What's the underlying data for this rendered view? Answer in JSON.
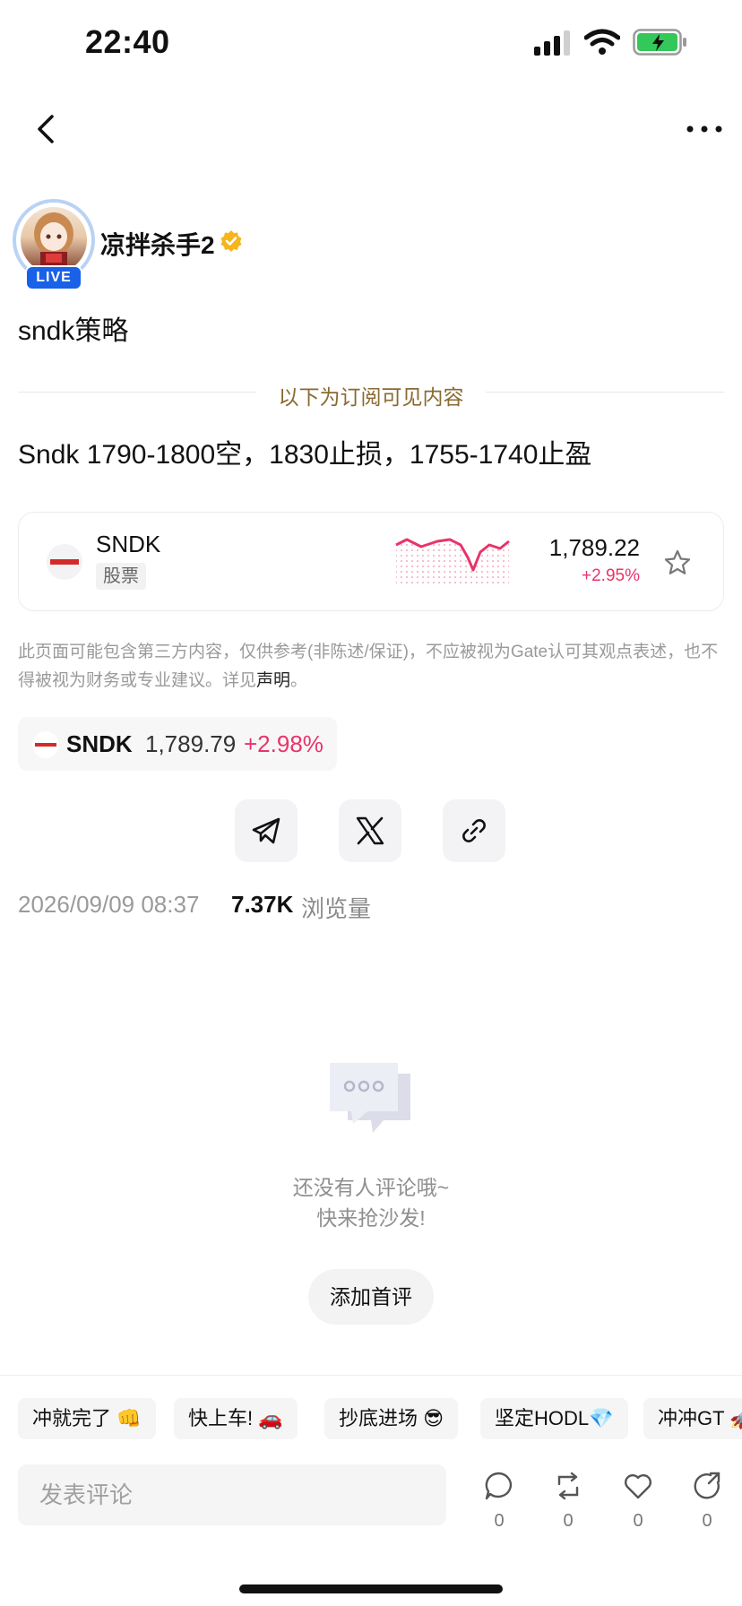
{
  "status_bar": {
    "time": "22:40"
  },
  "author": {
    "name": "凉拌杀手2",
    "live_badge": "LIVE"
  },
  "post": {
    "title": "sndk策略",
    "subscription_divider": "以下为订阅可见内容",
    "body": "Sndk 1790-1800空，1830止损，1755-1740止盈"
  },
  "stock_card": {
    "symbol": "SNDK",
    "type": "股票",
    "price": "1,789.22",
    "change": "+2.95%",
    "change_color": "#e8346a"
  },
  "disclaimer": {
    "text": "此页面可能包含第三方内容，仅供参考(非陈述/保证)，不应被视为Gate认可其观点表述，也不得被视为财务或专业建议。详见",
    "link": "声明",
    "suffix": "。"
  },
  "ticker_chip": {
    "symbol": "SNDK",
    "price": "1,789.79",
    "change": "+2.98%"
  },
  "meta": {
    "date": "2026/09/09 08:37",
    "views_count": "7.37K",
    "views_label": "浏览量"
  },
  "empty_state": {
    "line1": "还没有人评论哦~",
    "line2": "快来抢沙发!",
    "button": "添加首评"
  },
  "quick_replies": [
    "冲就完了 👊",
    "快上车! 🚗",
    "抄底进场 😎",
    "坚定HODL💎",
    "冲冲GT 🚀"
  ],
  "comment_box": {
    "placeholder": "发表评论"
  },
  "actions": {
    "comments": "0",
    "reposts": "0",
    "likes": "0",
    "shares": "0"
  },
  "icons": [
    "back-icon",
    "more-icon",
    "verified-icon",
    "star-icon",
    "telegram-icon",
    "x-icon",
    "link-icon",
    "comment-bubble-icon",
    "repost-icon",
    "heart-icon",
    "share-arrow-icon"
  ],
  "colors": {
    "accent_live": "#1861e8",
    "positive": "#e8346a",
    "subscription_text": "#8a6a32"
  }
}
